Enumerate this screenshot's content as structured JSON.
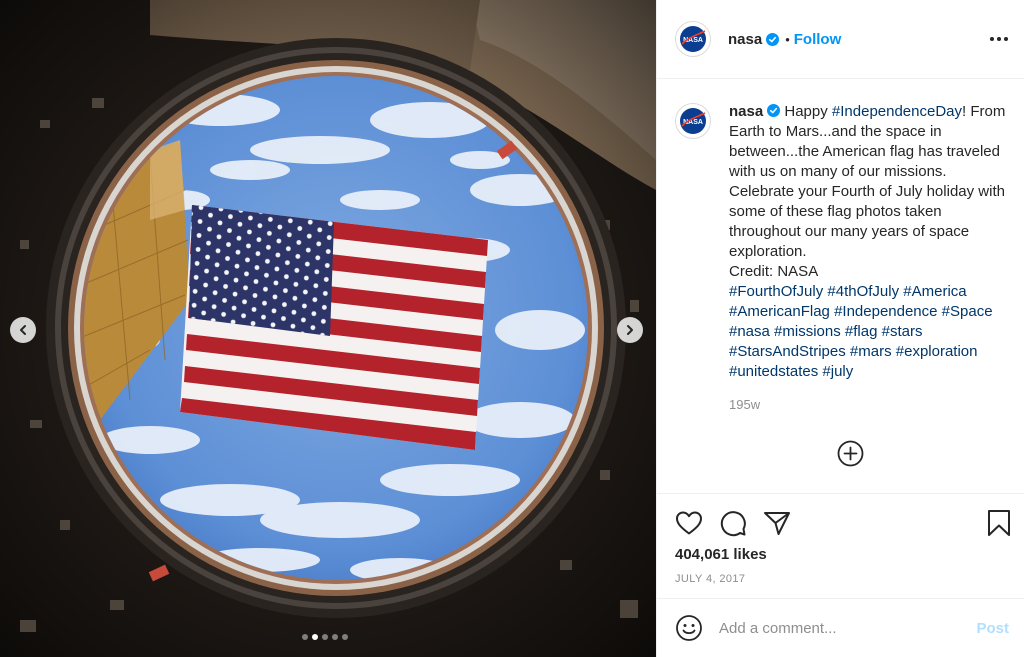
{
  "post": {
    "username": "nasa",
    "follow_label": "Follow",
    "separator": "•",
    "caption": {
      "username": "nasa",
      "segments": [
        {
          "text": " Happy ",
          "tag": false
        },
        {
          "text": "#IndependenceDay",
          "tag": true
        },
        {
          "text": "! From Earth to Mars...and the space in between...the American flag has traveled with us on many of our missions. Celebrate your Fourth of July holiday with some of these flag photos taken throughout our many years of space exploration.",
          "tag": false
        }
      ],
      "credit": "Credit: NASA",
      "hashtags": [
        "#FourthOfJuly",
        "#4thOfJuly",
        "#America",
        "#AmericanFlag",
        "#Independence",
        "#Space",
        "#nasa",
        "#missions",
        "#flag",
        "#stars",
        "#StarsAndStripes",
        "#mars",
        "#exploration",
        "#unitedstates",
        "#july"
      ]
    },
    "time_ago": "195w",
    "likes": "404,061 likes",
    "date": "JULY 4, 2017",
    "comment_placeholder": "Add a comment...",
    "post_label": "Post",
    "carousel": {
      "count": 5,
      "active_index": 1
    }
  },
  "icons": {
    "verified": "verified-badge-icon",
    "more": "more-options-icon",
    "load_more": "plus-circle-icon",
    "like": "heart-icon",
    "comment": "comment-icon",
    "share": "share-icon",
    "save": "bookmark-icon",
    "emoji": "emoji-icon",
    "prev": "chevron-left-icon",
    "next": "chevron-right-icon"
  },
  "colors": {
    "accent": "#0095f6",
    "hashtag": "#00376b",
    "muted": "#8e8e8e",
    "post_disabled": "#b2dffc"
  }
}
